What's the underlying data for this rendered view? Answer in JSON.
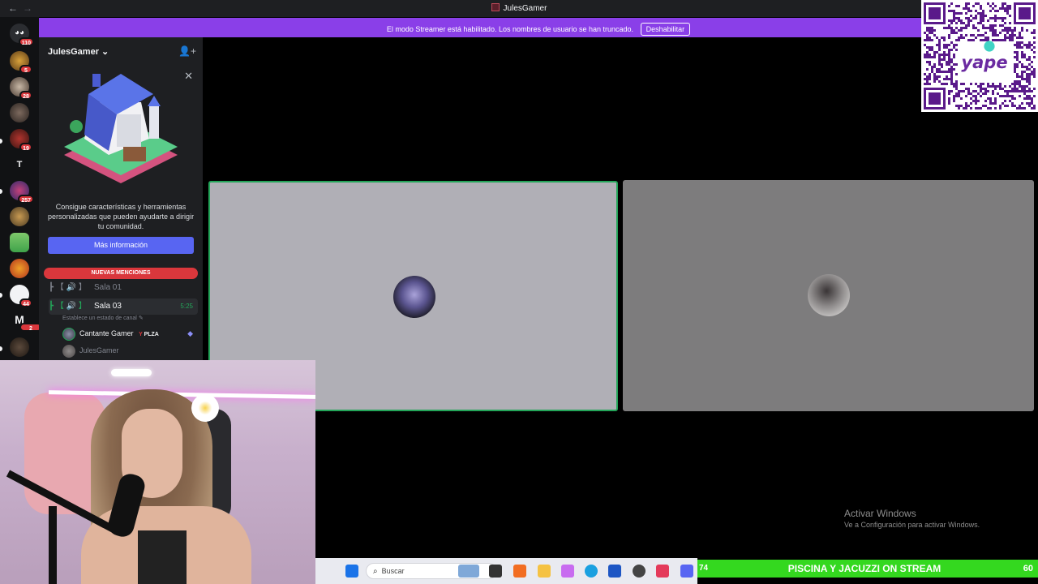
{
  "window": {
    "title": "JulesGamer",
    "back": "←",
    "forward": "→"
  },
  "banner": {
    "text": "El modo Streamer está habilitado. Los nombres de usuario se han truncado.",
    "button": "Deshabilitar",
    "color": "#8a3fe8"
  },
  "rail": {
    "badges": [
      "110",
      "5",
      "28",
      "19",
      "257",
      "44",
      "2"
    ],
    "letters": [
      "T",
      "M"
    ]
  },
  "sidebar": {
    "server_name": "JulesGamer",
    "promo_text": "Consigue características y herramientas personalizadas que pueden ayudarte a dirigir tu comunidad.",
    "more_button": "Más información",
    "mentions_bar": "NUEVAS MENCIONES",
    "channels": [
      {
        "icons": "┣ 【 🔊 】",
        "name": "Sala 01"
      },
      {
        "icons": "┣ 【 🔊 】",
        "name": "Sala 03",
        "time": "5:25",
        "status": "Establece un estado de canal"
      }
    ],
    "users": [
      {
        "name": "Cantante Gamer",
        "tag": "PLZA"
      },
      {
        "name": "JulesGamer"
      }
    ]
  },
  "watermark": {
    "line1": "Activar Windows",
    "line2": "Ve a Configuración para activar Windows."
  },
  "taskbar": {
    "search_placeholder": "Buscar"
  },
  "ticker": {
    "left_num": "74",
    "text": "PISCINA Y JACUZZI ON STREAM",
    "right_num": "60",
    "color": "#34d81f"
  },
  "qr": {
    "brand": "yape"
  }
}
